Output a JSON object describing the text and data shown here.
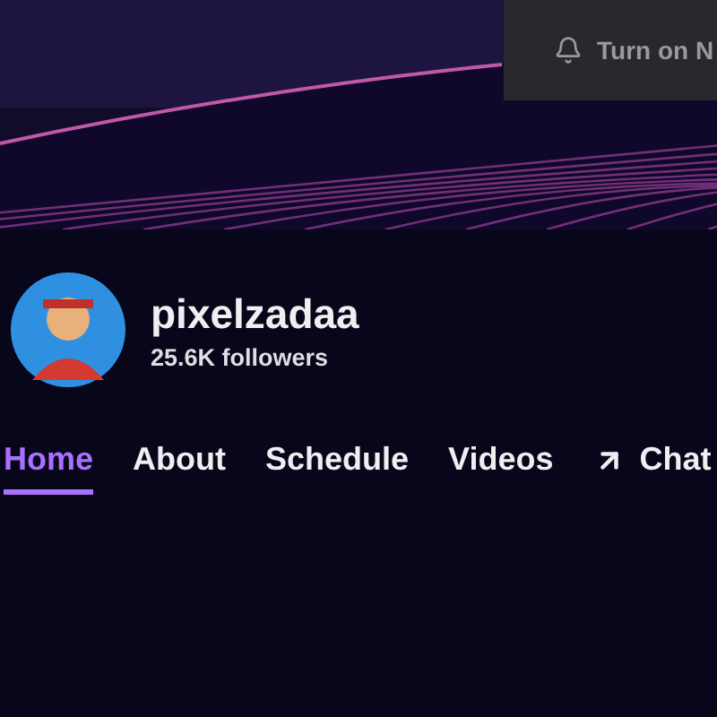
{
  "banner": {
    "notify_button": {
      "label": "Turn on N"
    }
  },
  "channel": {
    "name": "pixelzadaa",
    "followers": "25.6K followers"
  },
  "tabs": [
    {
      "label": "Home",
      "selected": true,
      "kind": "plain"
    },
    {
      "label": "About",
      "selected": false,
      "kind": "plain"
    },
    {
      "label": "Schedule",
      "selected": false,
      "kind": "plain"
    },
    {
      "label": "Videos",
      "selected": false,
      "kind": "plain"
    },
    {
      "label": "Chat",
      "selected": false,
      "kind": "external"
    }
  ]
}
